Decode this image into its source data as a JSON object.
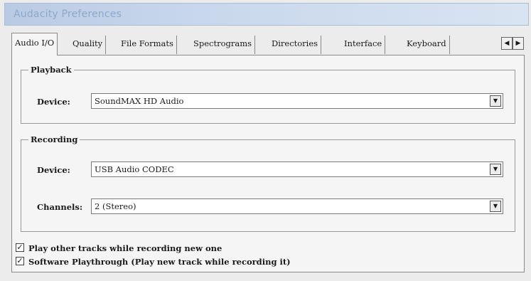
{
  "window": {
    "title": "Audacity Preferences"
  },
  "tabs": [
    {
      "label": "Audio I/O"
    },
    {
      "label": "Quality"
    },
    {
      "label": "File Formats"
    },
    {
      "label": "Spectrograms"
    },
    {
      "label": "Directories"
    },
    {
      "label": "Interface"
    },
    {
      "label": "Keyboard"
    }
  ],
  "tab_scroll": {
    "left": "◀",
    "right": "▶"
  },
  "playback": {
    "group_label": "Playback",
    "device_label": "Device:",
    "device_value": "SoundMAX HD Audio"
  },
  "recording": {
    "group_label": "Recording",
    "device_label": "Device:",
    "device_value": "USB Audio CODEC",
    "channels_label": "Channels:",
    "channels_value": "2 (Stereo)"
  },
  "options": [
    {
      "label": "Play other tracks while recording new one",
      "checked": true
    },
    {
      "label": "Software Playthrough (Play new track while recording it)",
      "checked": true
    }
  ],
  "check_mark": "✓",
  "dropdown_arrow": "▼"
}
